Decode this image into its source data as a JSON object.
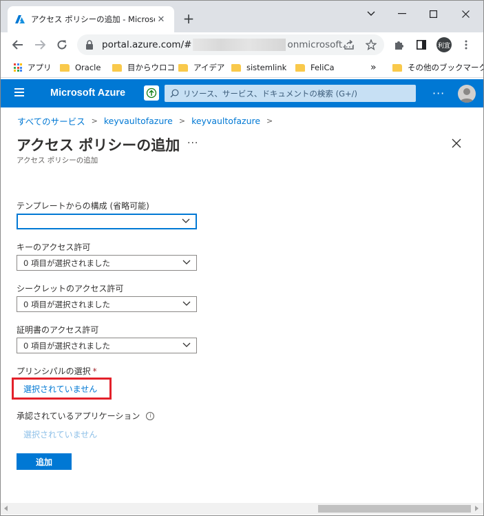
{
  "browser": {
    "tab_title": "アクセス ポリシーの追加 - Microsoft",
    "tab_close": "✕",
    "new_tab": "+",
    "window_controls": {
      "menu": "⌄",
      "minimize": "—",
      "maximize": "□",
      "close": "✕"
    },
    "url_prefix": "portal.azure.com/#",
    "url_suffix": "onmicrosoft....",
    "profile_initials": "利宜",
    "bookmarks": [
      {
        "label": "アプリ",
        "icon": "apps-icon"
      },
      {
        "label": "Oracle",
        "icon": "folder-icon"
      },
      {
        "label": "目からウロコ",
        "icon": "folder-icon"
      },
      {
        "label": "アイデア",
        "icon": "folder-icon"
      },
      {
        "label": "sistemlink",
        "icon": "folder-icon"
      },
      {
        "label": "FeliCa",
        "icon": "folder-icon"
      }
    ],
    "bookmarks_overflow": "»",
    "other_bookmarks": "その他のブックマーク"
  },
  "azure_header": {
    "brand": "Microsoft Azure",
    "search_placeholder": "リソース、サービス、ドキュメントの検索 (G+/)",
    "more": "···"
  },
  "breadcrumb": [
    "すべてのサービス",
    "keyvaultofazure",
    "keyvaultofazure"
  ],
  "page": {
    "title": "アクセス ポリシーの追加",
    "title_more": "···",
    "subtitle": "アクセス ポリシーの追加"
  },
  "form": {
    "template_label": "テンプレートからの構成 (省略可能)",
    "template_value": "",
    "key_label": "キーのアクセス許可",
    "key_value": "0 項目が選択されました",
    "secret_label": "シークレットのアクセス許可",
    "secret_value": "0 項目が選択されました",
    "cert_label": "証明書のアクセス許可",
    "cert_value": "0 項目が選択されました",
    "principal_label": "プリンシパルの選択",
    "principal_required": "*",
    "principal_link": "選択されていません",
    "apps_label": "承認されているアプリケーション",
    "apps_info": "i",
    "apps_link": "選択されていません",
    "add_button": "追加"
  },
  "colors": {
    "azure_blue": "#0078d4",
    "highlight_red": "#e3202a",
    "folder_yellow": "#f9c94b"
  }
}
